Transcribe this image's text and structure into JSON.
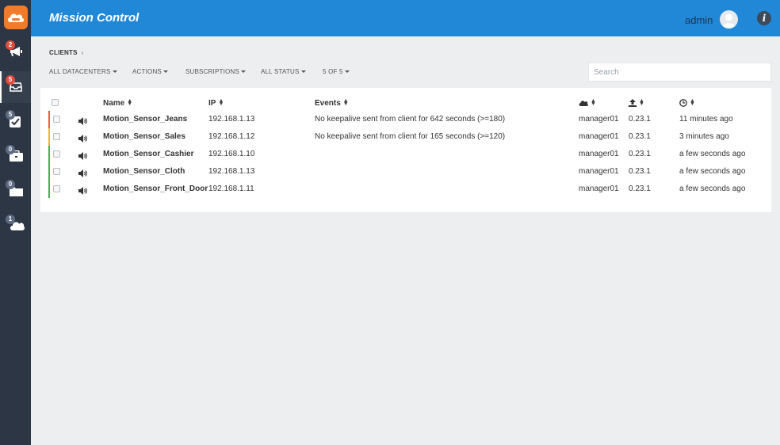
{
  "app": {
    "title": "Mission Control",
    "brand_color": "#2188d8",
    "sidebar_color": "#2d3644"
  },
  "header": {
    "user": "admin",
    "avatar_icon": "user-avatar-icon",
    "info_icon": "info-icon"
  },
  "sidebar": {
    "items": [
      {
        "icon": "megaphone-icon",
        "badge": "2",
        "badge_color": "#e04a3b"
      },
      {
        "icon": "inbox-icon",
        "badge": "5",
        "badge_color": "#e04a3b"
      },
      {
        "icon": "checkbox-icon",
        "badge": "5",
        "badge_color": "#5c6a82"
      },
      {
        "icon": "briefcase-icon",
        "badge": "0",
        "badge_color": "#5c6a82"
      },
      {
        "icon": "folder-icon",
        "badge": "0",
        "badge_color": "#5c6a82"
      },
      {
        "icon": "cloud-icon",
        "badge": "1",
        "badge_color": "#5c6a82"
      }
    ]
  },
  "breadcrumb": {
    "label": "CLIENTS",
    "separator": "›"
  },
  "toolbar": {
    "datacenters": "ALL DATACENTERS",
    "actions": "ACTIONS",
    "subscriptions": "SUBSCRIPTIONS",
    "status": "ALL STATUS",
    "count": "5 OF 5"
  },
  "search": {
    "placeholder": "Search"
  },
  "table": {
    "headers": {
      "name": "Name",
      "ip": "IP",
      "events": "Events"
    },
    "header_icons": [
      "cloud-icon",
      "upload-icon",
      "clock-icon"
    ],
    "rows": [
      {
        "name": "Motion_Sensor_Jeans",
        "ip": "192.168.1.13",
        "event": "No keepalive sent from client for 642 seconds (>=180)",
        "datacenter": "manager01",
        "version": "0.23.1",
        "time": "11 minutes ago",
        "status_color": "#e0663b"
      },
      {
        "name": "Motion_Sensor_Sales",
        "ip": "192.168.1.12",
        "event": "No keepalive sent from client for 165 seconds (>=120)",
        "datacenter": "manager01",
        "version": "0.23.1",
        "time": "3 minutes ago",
        "status_color": "#f0b43c"
      },
      {
        "name": "Motion_Sensor_Cashier",
        "ip": "192.168.1.10",
        "event": "",
        "datacenter": "manager01",
        "version": "0.23.1",
        "time": "a few seconds ago",
        "status_color": "#4caf50"
      },
      {
        "name": "Motion_Sensor_Cloth",
        "ip": "192.168.1.13",
        "event": "",
        "datacenter": "manager01",
        "version": "0.23.1",
        "time": "a few seconds ago",
        "status_color": "#4caf50"
      },
      {
        "name": "Motion_Sensor_Front_Door",
        "ip": "192.168.1.11",
        "event": "",
        "datacenter": "manager01",
        "version": "0.23.1",
        "time": "a few seconds ago",
        "status_color": "#4caf50"
      }
    ]
  }
}
